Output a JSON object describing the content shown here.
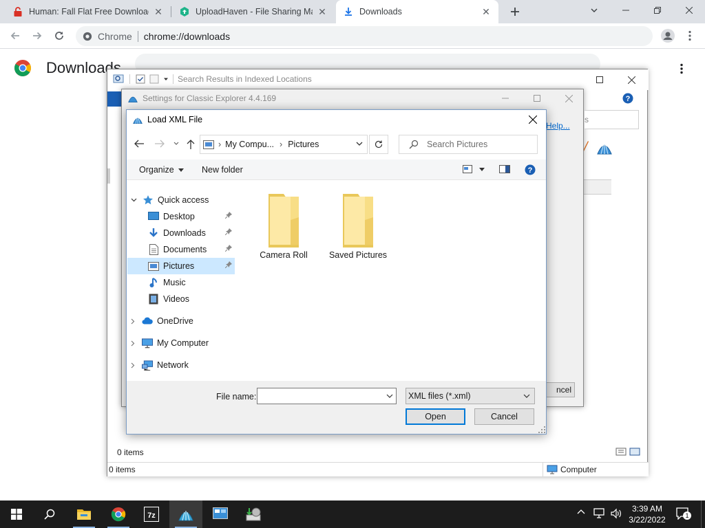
{
  "browser": {
    "tabs": [
      {
        "title": "Human: Fall Flat Free Download (",
        "icon": "lock-icon"
      },
      {
        "title": "UploadHaven - File Sharing Mad",
        "icon": "uploadhaven-icon"
      },
      {
        "title": "Downloads",
        "icon": "download-icon"
      }
    ],
    "address": {
      "label": "Chrome",
      "url": "chrome://downloads"
    },
    "page_title": "Downloads"
  },
  "explorer": {
    "address_text": "Search Results in Indexed Locations",
    "help_link": "Help...",
    "status_items": "0 items",
    "status_items_bottom": "0 items",
    "status_location": "Computer",
    "cancel_partial": "ncel"
  },
  "settings_window": {
    "title": "Settings for Classic Explorer 4.4.169"
  },
  "dialog": {
    "title": "Load XML File",
    "breadcrumb": [
      "My Compu...",
      "Pictures"
    ],
    "search_placeholder": "Search Pictures",
    "organize": "Organize",
    "new_folder": "New folder",
    "tree": {
      "quick_access": "Quick access",
      "desktop": "Desktop",
      "downloads": "Downloads",
      "documents": "Documents",
      "pictures": "Pictures",
      "music": "Music",
      "videos": "Videos",
      "onedrive": "OneDrive",
      "my_computer": "My Computer",
      "network": "Network"
    },
    "folders": [
      "Camera Roll",
      "Saved Pictures"
    ],
    "file_name_label": "File name:",
    "file_name_value": "",
    "file_type": "XML files (*.xml)",
    "open": "Open",
    "cancel": "Cancel"
  },
  "taskbar": {
    "time": "3:39 AM",
    "date": "3/22/2022",
    "notification_count": "1"
  }
}
